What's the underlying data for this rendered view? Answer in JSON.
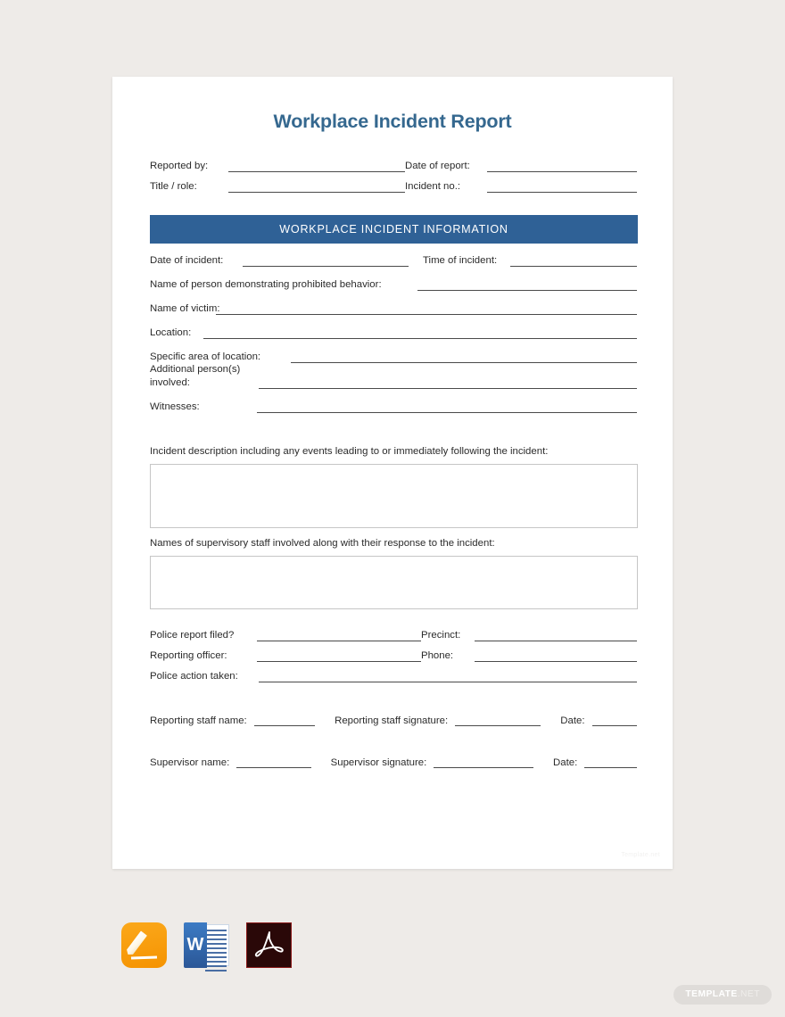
{
  "document": {
    "title": "Workplace Incident Report",
    "banner": "WORKPLACE INCIDENT INFORMATION",
    "watermark": "Template.net",
    "accent_color": "#2F6196",
    "title_color": "#35688F",
    "page_background": "#EEEBE8",
    "card_background": "#FFFFFF"
  },
  "header_fields": {
    "reported_by": "Reported by:",
    "date_of_report": "Date of report:",
    "title_role": "Title / role:",
    "incident_no": "Incident no.:"
  },
  "incident_fields": {
    "date_of_incident": "Date of incident:",
    "time_of_incident": "Time of incident:",
    "prohibited_behavior": "Name of person demonstrating prohibited behavior:",
    "name_of_victim": "Name of victim:",
    "location": "Location:",
    "specific_area": "Specific area of location:",
    "additional_persons": "Additional person(s) involved:",
    "witnesses": "Witnesses:"
  },
  "descriptions": {
    "incident_description_label": "Incident description including any events leading to or immediately following the incident:",
    "incident_description_value": "",
    "supervisory_staff_label": "Names of supervisory staff involved along with their response to the incident:",
    "supervisory_staff_value": ""
  },
  "police_fields": {
    "police_report_filed": "Police report filed?",
    "precinct": "Precinct:",
    "reporting_officer": "Reporting officer:",
    "phone": "Phone:",
    "police_action_taken": "Police action taken:"
  },
  "signature_fields": {
    "reporting_staff_name": "Reporting staff name:",
    "reporting_staff_signature": "Reporting staff signature:",
    "reporting_staff_date": "Date:",
    "supervisor_name": "Supervisor name:",
    "supervisor_signature": "Supervisor signature:",
    "supervisor_date": "Date:"
  },
  "file_formats": [
    {
      "name": "apple-pages",
      "label": "Pages"
    },
    {
      "name": "microsoft-word",
      "label": "W"
    },
    {
      "name": "adobe-pdf",
      "label": "PDF"
    }
  ],
  "brand": {
    "name_bold": "TEMPLATE",
    "name_light": ".NET"
  }
}
